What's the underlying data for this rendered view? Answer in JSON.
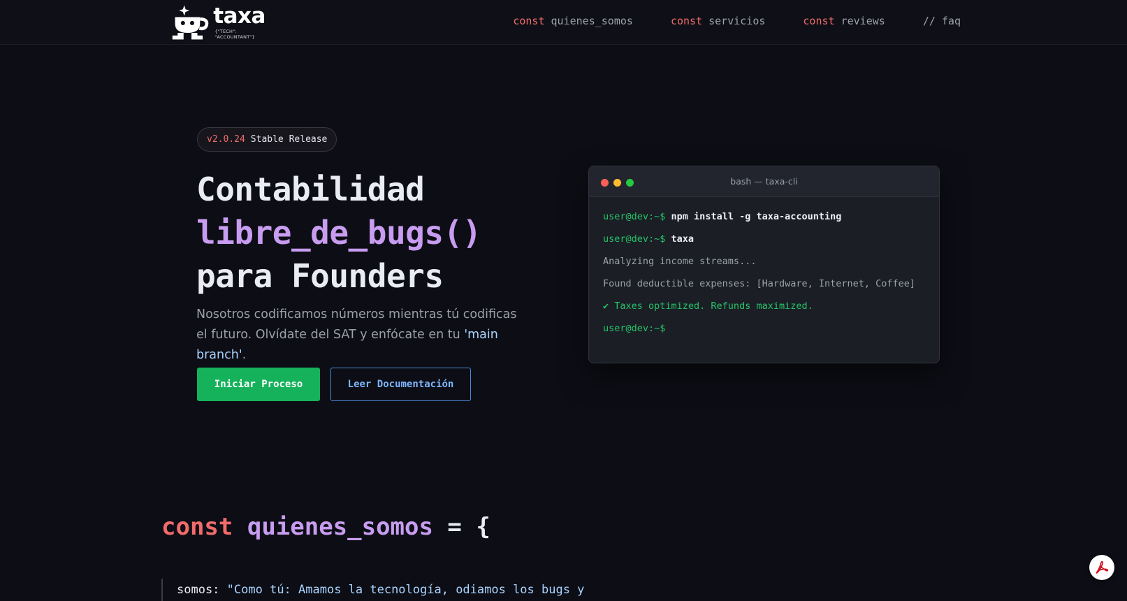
{
  "header": {
    "logo": {
      "word": "taxa",
      "tagline": "{\"TECH\": \"ACCOUNTANT\"}"
    },
    "nav": [
      {
        "keyword": "const",
        "label": "quienes_somos"
      },
      {
        "keyword": "const",
        "label": "servicios"
      },
      {
        "keyword": "const",
        "label": "reviews"
      },
      {
        "keyword": "//",
        "label": "faq"
      }
    ]
  },
  "hero": {
    "badge": {
      "version": "v2.0.24",
      "label": "Stable Release"
    },
    "title": {
      "line1": "Contabilidad",
      "line2": "libre_de_bugs()",
      "line3": "para Founders"
    },
    "description": {
      "text": "Nosotros codificamos números mientras tú codificas el futuro. Olvídate del SAT y enfócate en tu ",
      "highlight": "'main branch'",
      "end": "."
    },
    "primary_button": "Iniciar Proceso",
    "secondary_button": "Leer Documentación"
  },
  "terminal": {
    "title": "bash — taxa-cli",
    "lines": [
      {
        "prompt": "user@dev:~$",
        "cmd": "npm install -g taxa-accounting"
      },
      {
        "prompt": "user@dev:~$",
        "cmd": "taxa"
      },
      {
        "out": "Analyzing income streams..."
      },
      {
        "out": "Found deductible expenses: [Hardware, Internet, Coffee]"
      },
      {
        "ok": "✔ Taxes optimized. Refunds maximized."
      },
      {
        "prompt": "user@dev:~$",
        "cmd": ""
      }
    ]
  },
  "section": {
    "keyword": "const",
    "name": "quienes_somos",
    "rest": " = {",
    "key": "somos:",
    "value": "\"Como tú: Amamos la tecnología, odiamos los bugs y"
  },
  "colors": {
    "background": "#0d0e15",
    "keyword": "#f26b6b",
    "accent_purple": "#c89cf0",
    "primary_green": "#16b25b",
    "secondary_blue": "#4d88d8"
  },
  "icons": {
    "pdf_button": "adobe-pdf-icon",
    "logo": "taxa-robot-logo-icon"
  }
}
